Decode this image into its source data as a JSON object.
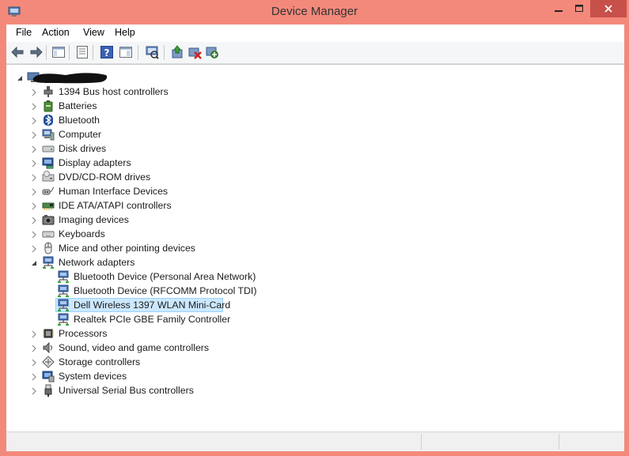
{
  "window": {
    "title": "Device Manager"
  },
  "menu": {
    "items": [
      "File",
      "Action",
      "View",
      "Help"
    ]
  },
  "toolbar": {
    "buttons": [
      "back-icon",
      "forward-icon",
      "show-hide-console-tree-icon",
      "properties-icon",
      "help-icon",
      "action-pane-icon",
      "scan-hardware-icon",
      "update-driver-icon",
      "disable-device-icon",
      "uninstall-device-icon"
    ]
  },
  "tree": {
    "root": {
      "label": "",
      "expanded": true
    },
    "categories": [
      {
        "label": "1394 Bus host controllers",
        "icon": "bus-controller-icon",
        "expanded": false
      },
      {
        "label": "Batteries",
        "icon": "battery-icon",
        "expanded": false
      },
      {
        "label": "Bluetooth",
        "icon": "bluetooth-icon",
        "expanded": false
      },
      {
        "label": "Computer",
        "icon": "computer-icon",
        "expanded": false
      },
      {
        "label": "Disk drives",
        "icon": "disk-drive-icon",
        "expanded": false
      },
      {
        "label": "Display adapters",
        "icon": "display-adapter-icon",
        "expanded": false
      },
      {
        "label": "DVD/CD-ROM drives",
        "icon": "dvd-drive-icon",
        "expanded": false
      },
      {
        "label": "Human Interface Devices",
        "icon": "hid-icon",
        "expanded": false
      },
      {
        "label": "IDE ATA/ATAPI controllers",
        "icon": "ide-controller-icon",
        "expanded": false
      },
      {
        "label": "Imaging devices",
        "icon": "camera-icon",
        "expanded": false
      },
      {
        "label": "Keyboards",
        "icon": "keyboard-icon",
        "expanded": false
      },
      {
        "label": "Mice and other pointing devices",
        "icon": "mouse-icon",
        "expanded": false
      },
      {
        "label": "Network adapters",
        "icon": "network-adapter-icon",
        "expanded": true
      },
      {
        "label": "Processors",
        "icon": "processor-icon",
        "expanded": false
      },
      {
        "label": "Sound, video and game controllers",
        "icon": "speaker-icon",
        "expanded": false
      },
      {
        "label": "Storage controllers",
        "icon": "storage-controller-icon",
        "expanded": false
      },
      {
        "label": "System devices",
        "icon": "system-device-icon",
        "expanded": false
      },
      {
        "label": "Universal Serial Bus controllers",
        "icon": "usb-icon",
        "expanded": false
      }
    ],
    "network_children": [
      {
        "label": "Bluetooth Device (Personal Area Network)",
        "selected": false
      },
      {
        "label": "Bluetooth Device (RFCOMM Protocol TDI)",
        "selected": false
      },
      {
        "label": "Dell Wireless 1397 WLAN Mini-Card",
        "selected": true
      },
      {
        "label": "Realtek PCIe GBE Family Controller",
        "selected": false
      }
    ]
  },
  "colors": {
    "frame": "#f3897b",
    "close": "#c7504a",
    "selection": "#cce8ff",
    "selection_border": "#99d1ff"
  }
}
